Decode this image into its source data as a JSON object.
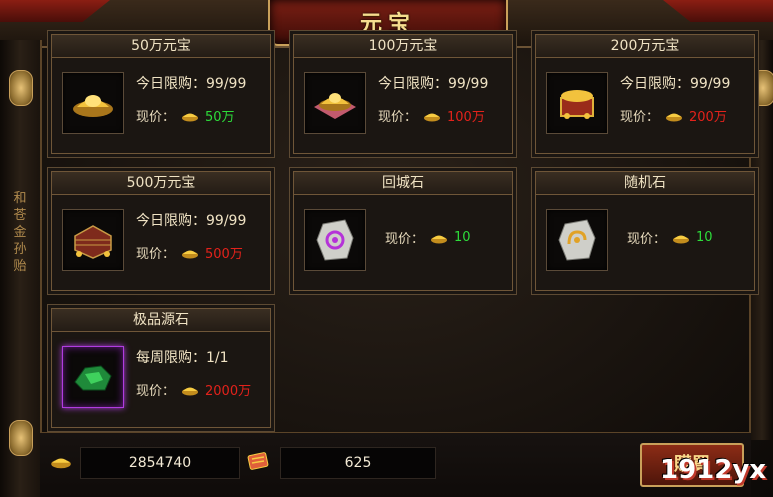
{
  "window": {
    "title": "元宝"
  },
  "sidebar": {
    "vertical_text": "和 苍 金 孙 贻"
  },
  "items": [
    {
      "name": "50万元宝",
      "limit": "今日限购：99/99",
      "price_label": "现价：",
      "price": "50万",
      "price_color": "green"
    },
    {
      "name": "100万元宝",
      "limit": "今日限购：99/99",
      "price_label": "现价：",
      "price": "100万",
      "price_color": "red"
    },
    {
      "name": "200万元宝",
      "limit": "今日限购：99/99",
      "price_label": "现价：",
      "price": "200万",
      "price_color": "red"
    },
    {
      "name": "500万元宝",
      "limit": "今日限购：99/99",
      "price_label": "现价：",
      "price": "500万",
      "price_color": "red"
    },
    {
      "name": "回城石",
      "price_label": "现价：",
      "price": "10",
      "price_color": "green"
    },
    {
      "name": "随机石",
      "price_label": "现价：",
      "price": "10",
      "price_color": "green"
    },
    {
      "name": "极品源石",
      "limit": "每周限购：1/1",
      "price_label": "现价：",
      "price": "2000万",
      "price_color": "red"
    }
  ],
  "footer": {
    "gold_amount": "2854740",
    "ticket_amount": "625",
    "buy_label": "購買"
  },
  "watermark": "1912yx",
  "colors": {
    "green": "#2ddc3a",
    "red": "#e3221b",
    "accent": "#c9a05a"
  }
}
